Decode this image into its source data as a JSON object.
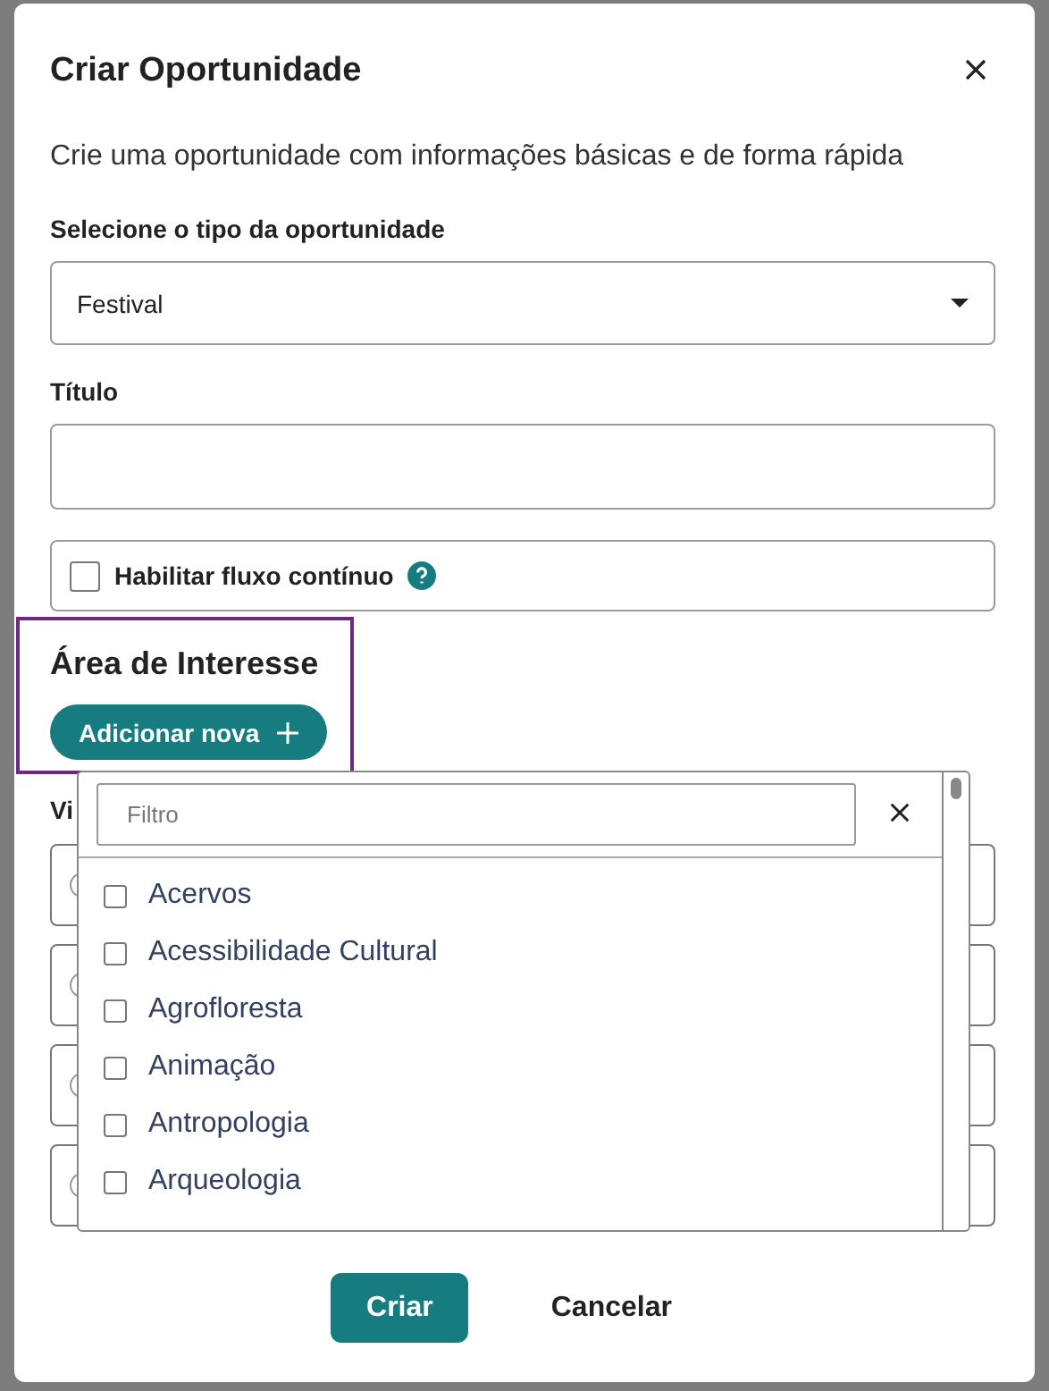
{
  "dialog": {
    "title": "Criar Oportunidade",
    "subtitle": "Crie uma oportunidade com informações básicas e de forma rápida",
    "type_field": {
      "label": "Selecione o tipo da oportunidade",
      "value": "Festival"
    },
    "title_field": {
      "label": "Título"
    },
    "continuous_flow": {
      "label": "Habilitar fluxo contínuo",
      "checked": false
    },
    "interest_area": {
      "heading": "Área de Interesse",
      "button": "Adicionar nova",
      "focused": true
    },
    "hidden_section": {
      "label": "Vi",
      "rows": [
        {
          "kind": "radio"
        },
        {
          "kind": "radio"
        },
        {
          "kind": "radio"
        },
        {
          "kind": "radio"
        }
      ]
    },
    "dropdown": {
      "placeholder": "Filtro",
      "options": [
        {
          "label": "Acervos",
          "checked": false
        },
        {
          "label": "Acessibilidade Cultural",
          "checked": false
        },
        {
          "label": "Agrofloresta",
          "checked": false
        },
        {
          "label": "Animação",
          "checked": false
        },
        {
          "label": "Antropologia",
          "checked": false
        },
        {
          "label": "Arqueologia",
          "checked": false
        }
      ]
    },
    "buttons": [
      {
        "label": "Criar",
        "kind": "primary"
      },
      {
        "label": "Cancelar",
        "kind": "secondary"
      }
    ]
  }
}
